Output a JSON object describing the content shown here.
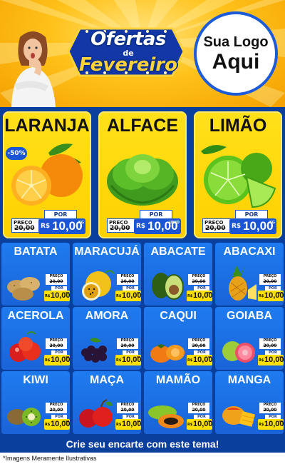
{
  "header": {
    "title_line1": "Ofertas",
    "title_de": "de",
    "title_line2": "Fevereiro",
    "logo_line1": "Sua Logo",
    "logo_line2": "Aqui"
  },
  "featured": [
    {
      "name": "LARANJA",
      "badge": "-50%",
      "preco_label": "PREÇO",
      "por_label": "POR",
      "old_price": "20,00",
      "currency": "R$",
      "new_price": "10,00",
      "unit": "KG",
      "icon": "orange-icon"
    },
    {
      "name": "ALFACE",
      "badge": "",
      "preco_label": "PREÇO",
      "por_label": "POR",
      "old_price": "20,00",
      "currency": "R$",
      "new_price": "10,00",
      "unit": "UNID",
      "icon": "lettuce-icon"
    },
    {
      "name": "LIMÃO",
      "badge": "",
      "preco_label": "PREÇO",
      "por_label": "POR",
      "old_price": "20,00",
      "currency": "R$",
      "new_price": "10,00",
      "unit": "KG",
      "icon": "lime-icon"
    }
  ],
  "grid": [
    {
      "name": "BATATA",
      "icon": "potato-icon",
      "preco_label": "PREÇO",
      "old_price": "20,00",
      "por_label": "POR",
      "currency": "R$",
      "new_price": "10,00",
      "unit": "KG"
    },
    {
      "name": "MARACUJÁ",
      "icon": "passion-fruit-icon",
      "preco_label": "PREÇO",
      "old_price": "20,00",
      "por_label": "POR",
      "currency": "R$",
      "new_price": "10,00",
      "unit": "KG"
    },
    {
      "name": "ABACATE",
      "icon": "avocado-icon",
      "preco_label": "PREÇO",
      "old_price": "20,00",
      "por_label": "POR",
      "currency": "R$",
      "new_price": "10,00",
      "unit": "UNID"
    },
    {
      "name": "ABACAXI",
      "icon": "pineapple-icon",
      "preco_label": "PREÇO",
      "old_price": "20,00",
      "por_label": "POR",
      "currency": "R$",
      "new_price": "10,00",
      "unit": "UNID"
    },
    {
      "name": "ACEROLA",
      "icon": "acerola-icon",
      "preco_label": "PREÇO",
      "old_price": "20,00",
      "por_label": "POR",
      "currency": "R$",
      "new_price": "10,00",
      "unit": "KG"
    },
    {
      "name": "AMORA",
      "icon": "blackberry-icon",
      "preco_label": "PREÇO",
      "old_price": "20,00",
      "por_label": "POR",
      "currency": "R$",
      "new_price": "10,00",
      "unit": "KG"
    },
    {
      "name": "CAQUI",
      "icon": "persimmon-icon",
      "preco_label": "PREÇO",
      "old_price": "20,00",
      "por_label": "POR",
      "currency": "R$",
      "new_price": "10,00",
      "unit": "KG"
    },
    {
      "name": "GOIABA",
      "icon": "guava-icon",
      "preco_label": "PREÇO",
      "old_price": "20,00",
      "por_label": "POR",
      "currency": "R$",
      "new_price": "10,00",
      "unit": "KG"
    },
    {
      "name": "KIWI",
      "icon": "kiwi-icon",
      "preco_label": "PREÇO",
      "old_price": "20,00",
      "por_label": "POR",
      "currency": "R$",
      "new_price": "10,00",
      "unit": "KG"
    },
    {
      "name": "MAÇA",
      "icon": "apple-icon",
      "preco_label": "PREÇO",
      "old_price": "20,00",
      "por_label": "POR",
      "currency": "R$",
      "new_price": "10,00",
      "unit": "KG"
    },
    {
      "name": "MAMÃO",
      "icon": "papaya-icon",
      "preco_label": "PREÇO",
      "old_price": "20,00",
      "por_label": "POR",
      "currency": "R$",
      "new_price": "10,00",
      "unit": "KG"
    },
    {
      "name": "MANGA",
      "icon": "mango-icon",
      "preco_label": "PREÇO",
      "old_price": "20,00",
      "por_label": "POR",
      "currency": "R$",
      "new_price": "10,00",
      "unit": "KG"
    }
  ],
  "footer": {
    "cta": "Crie seu encarte com este tema!",
    "disclaimer": "*Imagens Meramente Ilustrativas"
  },
  "colors": {
    "background_blue": "#0b3f9e",
    "card_blue": "#1f7bf0",
    "featured_yellow": "#ffe11a",
    "price_yellow": "#ffe000",
    "header_orange": "#ffc21a"
  }
}
